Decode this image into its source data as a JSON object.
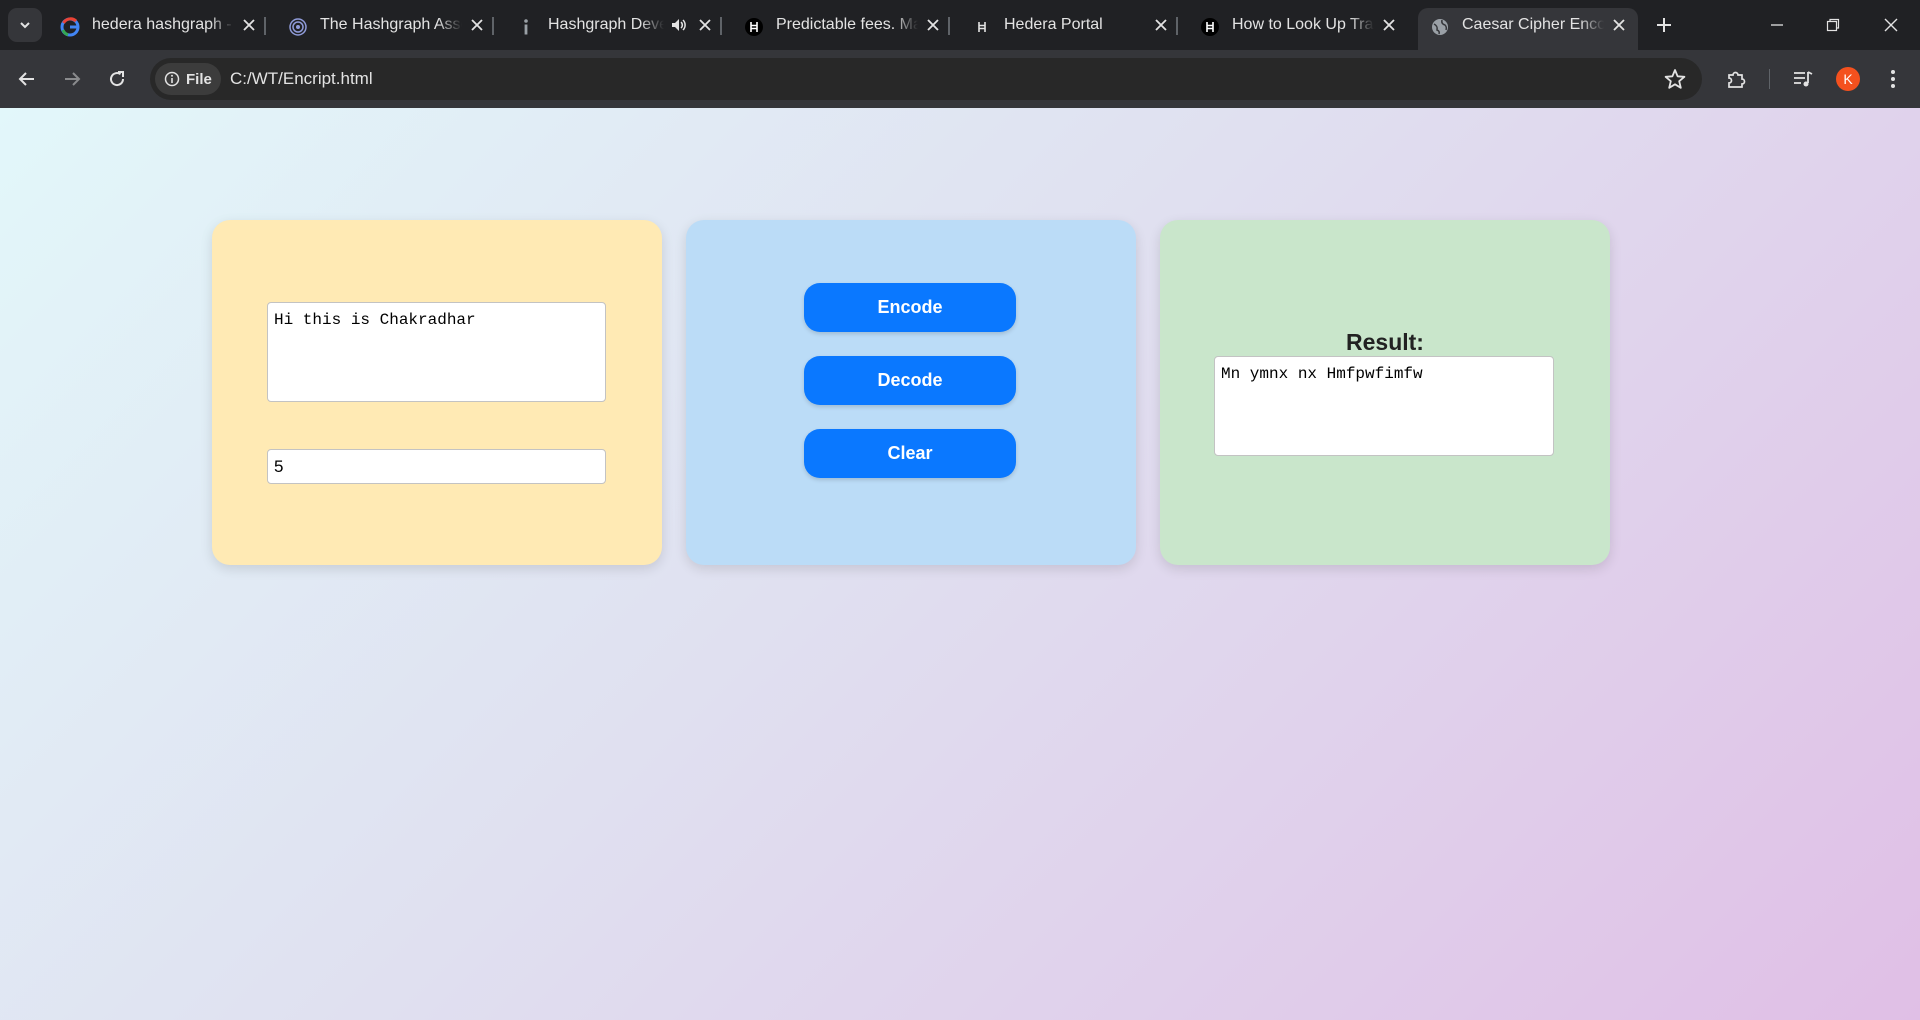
{
  "browser": {
    "tabs": [
      {
        "title": "hedera hashgraph - Google Search",
        "icon": "google-icon",
        "active": false
      },
      {
        "title": "The Hashgraph Association",
        "icon": "hashgraph-association-icon",
        "active": false
      },
      {
        "title": "Hashgraph Developer",
        "icon": "info-icon",
        "active": false,
        "audio": true
      },
      {
        "title": "Predictable fees. Made for business",
        "icon": "hedera-icon",
        "active": false
      },
      {
        "title": "Hedera Portal",
        "icon": "hedera-portal-icon",
        "active": false
      },
      {
        "title": "How to Look Up Transactions",
        "icon": "hedera-icon",
        "active": false
      },
      {
        "title": "Caesar Cipher Encoder",
        "icon": "globe-icon",
        "active": true
      }
    ],
    "address_bar": {
      "chip_label": "File",
      "url": "C:/WT/Encript.html"
    },
    "profile_initial": "K",
    "profile_color": "#f4511e"
  },
  "page": {
    "input_panel": {
      "message": "Hi this is Chakradhar",
      "shift": "5"
    },
    "controls": {
      "encode_label": "Encode",
      "decode_label": "Decode",
      "clear_label": "Clear"
    },
    "result_panel": {
      "label": "Result:",
      "value": "Mn ymnx nx Hmfpwfimfw"
    },
    "colors": {
      "input_card": "#ffeab4",
      "controls_card": "#bbdcf7",
      "result_card": "#c9e6cb",
      "button": "#0a78ff"
    }
  }
}
